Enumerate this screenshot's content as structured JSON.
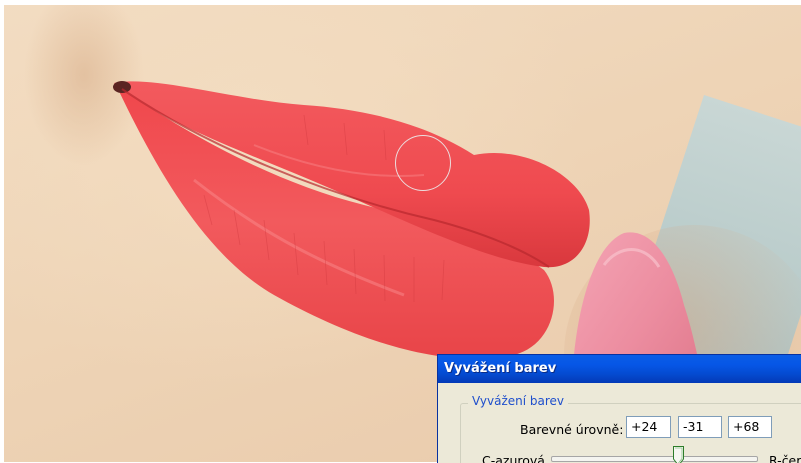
{
  "dialog": {
    "title": "Vyvážení barev",
    "group_title": "Vyvážení barev",
    "levels_label": "Barevné úrovně:",
    "levels": [
      "+24",
      "-31",
      "+68"
    ],
    "slider": {
      "left_label": "C-azurová",
      "right_label": "R-červená",
      "value": 24,
      "min": -100,
      "max": 100
    }
  },
  "colors": {
    "titlebar": "#0a5de6",
    "dialog_bg": "#ece9d8",
    "group_title": "#1f4fcc",
    "lip_red": "#f0444a"
  },
  "icons": {
    "cursor": "brush-circle-cursor-icon"
  }
}
